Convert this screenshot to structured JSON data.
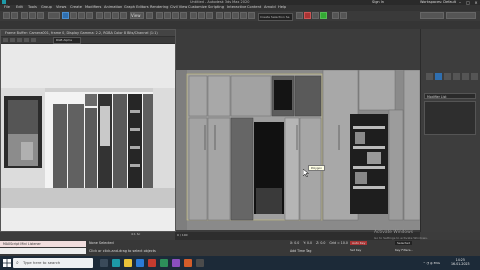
{
  "title_bar": {
    "title": "Untitled - Autodesk 3ds Max 2020",
    "sign_in": "Sign In",
    "workspaces": "Workspaces: Default"
  },
  "menu": [
    "File",
    "Edit",
    "Tools",
    "Group",
    "Views",
    "Create",
    "Modifiers",
    "Animation",
    "Graph Editors",
    "Rendering",
    "Civil View",
    "Customize",
    "Scripting",
    "Interactive",
    "Content",
    "Arnold",
    "Help"
  ],
  "toolbar": {
    "view_dropdown": "View",
    "selection_set": "Create Selection Se"
  },
  "viewport_float": {
    "title": "Frame Buffer: Camera001, frame 0, Display Gamma: 2.2, RGBA Color 8 Bits/Channel (1:1)",
    "dropdown": "RGB Alpha",
    "size_label": "4:1 Sc"
  },
  "right_panel": {
    "modifier_list": "Modifier List"
  },
  "timeline": {
    "frame": "0 / 100"
  },
  "status": {
    "maxscript": "MAXScript Mini Listener",
    "none_selected": "None Selected",
    "hint": "Click or click-and-drag to select objects",
    "x": "X: 0.0",
    "y": "Y: 0.0",
    "z": "Z: 0.0",
    "grid": "Grid = 10.0",
    "add_time_tag": "Add Time Tag",
    "auto_key": "Auto Key",
    "set_key": "Set Key",
    "key_filters": "Key Filters...",
    "selected": "Selected",
    "activate": "Activate Windows",
    "activate_sub": "Go to Settings to activate Windows."
  },
  "taskbar": {
    "search_placeholder": "Type here to search",
    "time": "14:25",
    "date": "16-01-2023"
  },
  "tooltip": {
    "text": "Polygon"
  }
}
